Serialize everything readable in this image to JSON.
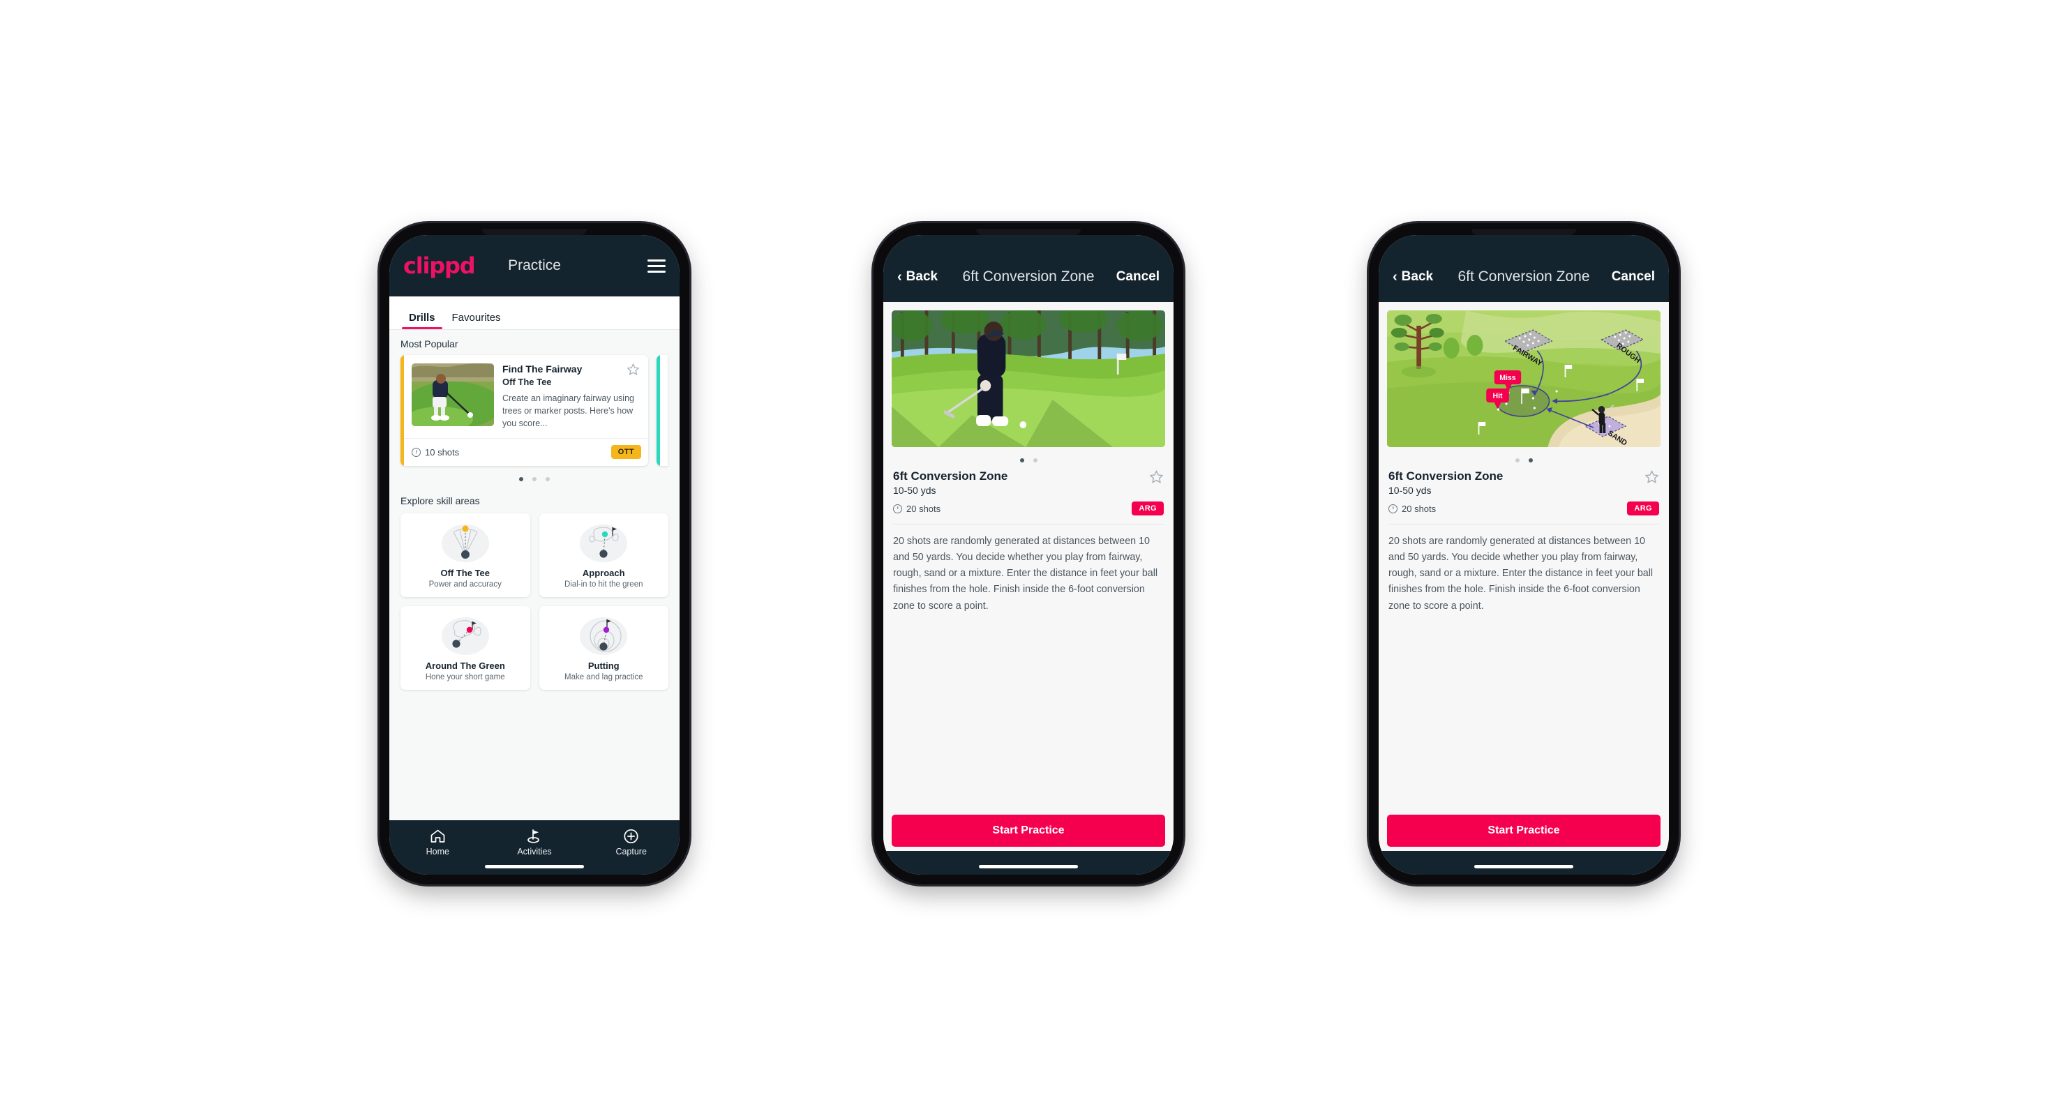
{
  "app": {
    "brand": "clippd",
    "accent_pink": "#ef1164",
    "accent_crimson": "#f5004f",
    "accent_amber": "#f5b61d",
    "dark_navy": "#14242e"
  },
  "phone1": {
    "header": {
      "logo_text": "clippd",
      "title": "Practice",
      "menu_icon": "hamburger-menu-icon"
    },
    "tabs": [
      {
        "label": "Drills",
        "active": true
      },
      {
        "label": "Favourites",
        "active": false
      }
    ],
    "most_popular": {
      "section_label": "Most Popular",
      "card": {
        "stripe_color": "#f5b61d",
        "title": "Find The Fairway",
        "subtitle": "Off The Tee",
        "description": "Create an imaginary fairway using trees or marker posts. Here's how you score...",
        "shots": "10 shots",
        "badge": "OTT",
        "favourite_icon": "star-outline-icon"
      },
      "next_card_stripe": "#2ad9bd",
      "dots": {
        "count": 3,
        "active_index": 0
      }
    },
    "skill_areas": {
      "section_label": "Explore skill areas",
      "items": [
        {
          "name": "Off The Tee",
          "desc": "Power and accuracy",
          "icon": "tee-shot-fan-icon",
          "accent": "#f5b61d"
        },
        {
          "name": "Approach",
          "desc": "Dial-in to hit the green",
          "icon": "approach-green-icon",
          "accent": "#2ad9bd"
        },
        {
          "name": "Around The Green",
          "desc": "Hone your short game",
          "icon": "around-green-icon",
          "accent": "#f5004f"
        },
        {
          "name": "Putting",
          "desc": "Make and lag practice",
          "icon": "putting-rings-icon",
          "accent": "#a21ed6"
        }
      ]
    },
    "bottom_nav": [
      {
        "label": "Home",
        "icon": "home-icon",
        "active": false
      },
      {
        "label": "Activities",
        "icon": "golf-flag-icon",
        "active": true
      },
      {
        "label": "Capture",
        "icon": "plus-circle-icon",
        "active": false
      }
    ]
  },
  "phone2": {
    "header": {
      "back_label": "Back",
      "back_icon": "chevron-left-icon",
      "title": "6ft Conversion Zone",
      "cancel_label": "Cancel"
    },
    "media": {
      "type": "photo",
      "alt": "golfer-chipping-photo"
    },
    "dots": {
      "count": 2,
      "active_index": 0
    },
    "drill": {
      "title": "6ft Conversion Zone",
      "distance": "10-50 yds",
      "shots": "20 shots",
      "badge": "ARG",
      "favourite_icon": "star-outline-icon",
      "description": "20 shots are randomly generated at distances between 10 and 50 yards. You decide whether you play from fairway, rough, sand or a mixture. Enter the distance in feet your ball finishes from the hole. Finish inside the 6-foot conversion zone to score a point."
    },
    "cta_label": "Start Practice"
  },
  "phone3": {
    "header": {
      "back_label": "Back",
      "back_icon": "chevron-left-icon",
      "title": "6ft Conversion Zone",
      "cancel_label": "Cancel"
    },
    "media": {
      "type": "illustration",
      "alt": "golf-course-diagram",
      "labels": [
        "FAIRWAY",
        "ROUGH",
        "SAND"
      ],
      "callouts": [
        "Miss",
        "Hit"
      ]
    },
    "dots": {
      "count": 2,
      "active_index": 1
    },
    "drill": {
      "title": "6ft Conversion Zone",
      "distance": "10-50 yds",
      "shots": "20 shots",
      "badge": "ARG",
      "favourite_icon": "star-outline-icon",
      "description": "20 shots are randomly generated at distances between 10 and 50 yards. You decide whether you play from fairway, rough, sand or a mixture. Enter the distance in feet your ball finishes from the hole. Finish inside the 6-foot conversion zone to score a point."
    },
    "cta_label": "Start Practice"
  }
}
